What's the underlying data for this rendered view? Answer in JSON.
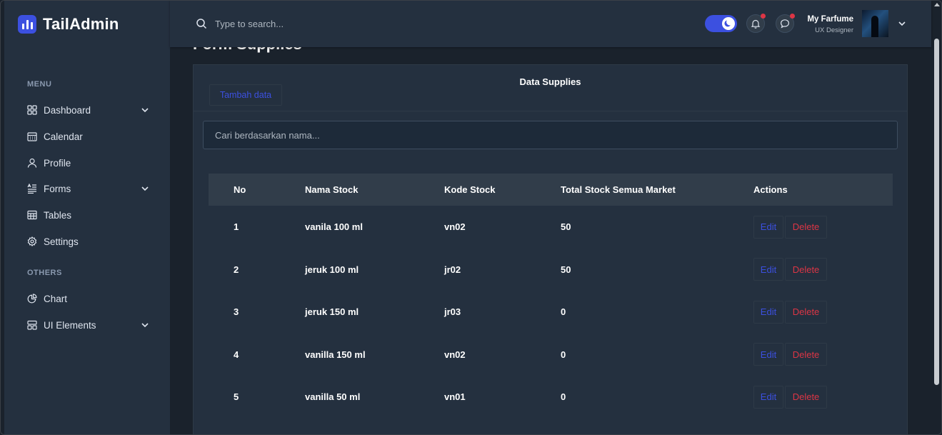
{
  "brand": {
    "name": "TailAdmin"
  },
  "sidebar": {
    "menu_label": "MENU",
    "items": [
      {
        "label": "Dashboard",
        "icon": "grid-icon",
        "has_submenu": true
      },
      {
        "label": "Calendar",
        "icon": "calendar-icon",
        "has_submenu": false
      },
      {
        "label": "Profile",
        "icon": "user-icon",
        "has_submenu": false
      },
      {
        "label": "Forms",
        "icon": "form-icon",
        "has_submenu": true
      },
      {
        "label": "Tables",
        "icon": "table-icon",
        "has_submenu": false
      },
      {
        "label": "Settings",
        "icon": "gear-icon",
        "has_submenu": false
      }
    ],
    "others_label": "OTHERS",
    "others": [
      {
        "label": "Chart",
        "icon": "pie-chart-icon",
        "has_submenu": false
      },
      {
        "label": "UI Elements",
        "icon": "layout-icon",
        "has_submenu": true
      }
    ]
  },
  "header": {
    "search": {
      "placeholder": "Type to search..."
    },
    "theme_toggle": {
      "mode": "dark"
    },
    "notifications": {
      "has_unread": true
    },
    "messages": {
      "has_unread": true
    },
    "user": {
      "name": "My Farfume",
      "role": "UX Designer"
    }
  },
  "page": {
    "title": "Form Supplies",
    "card_title": "Data Supplies",
    "add_button": "Tambah data",
    "filter_placeholder": "Cari berdasarkan nama..."
  },
  "table": {
    "columns": [
      "No",
      "Nama Stock",
      "Kode Stock",
      "Total Stock Semua Market",
      "Actions"
    ],
    "edit_label": "Edit",
    "delete_label": "Delete",
    "rows": [
      {
        "no": "1",
        "nama": "vanila 100 ml",
        "kode": "vn02",
        "total": "50"
      },
      {
        "no": "2",
        "nama": "jeruk 100 ml",
        "kode": "jr02",
        "total": "50"
      },
      {
        "no": "3",
        "nama": "jeruk 150 ml",
        "kode": "jr03",
        "total": "0"
      },
      {
        "no": "4",
        "nama": "vanilla 150 ml",
        "kode": "vn02",
        "total": "0"
      },
      {
        "no": "5",
        "nama": "vanilla 50 ml",
        "kode": "vn01",
        "total": "0"
      }
    ]
  },
  "colors": {
    "primary": "#3c50e0",
    "danger": "#dc3545",
    "sidebar_bg": "#24303f",
    "body_bg": "#1a222c"
  }
}
